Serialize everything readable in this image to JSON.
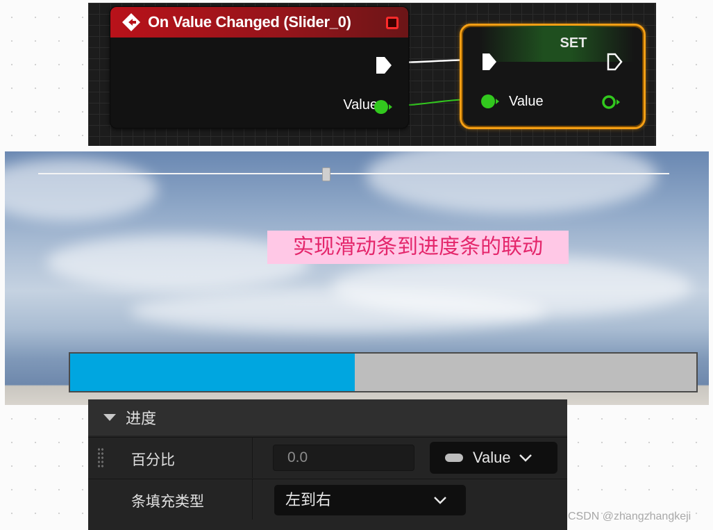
{
  "blueprint": {
    "event_node": {
      "title": "On Value Changed (Slider_0)",
      "output_label": "Value",
      "header_color": "#b8121a"
    },
    "set_node": {
      "title": "SET",
      "input_label": "Value",
      "border_color": "#f59f14"
    },
    "pin_colors": {
      "exec": "#ffffff",
      "float": "#32c81e"
    }
  },
  "viewport": {
    "slider": {
      "value": 0.45
    },
    "annotation": "实现滑动条到进度条的联动",
    "progress": {
      "percent": 0.455,
      "fill_color": "#00a6e0"
    }
  },
  "details": {
    "section_title": "进度",
    "rows": [
      {
        "label": "百分比",
        "value": "0.0",
        "binding": "Value"
      },
      {
        "label": "条填充类型",
        "value": "左到右"
      }
    ]
  },
  "watermark": "CSDN @zhangzhangkeji"
}
